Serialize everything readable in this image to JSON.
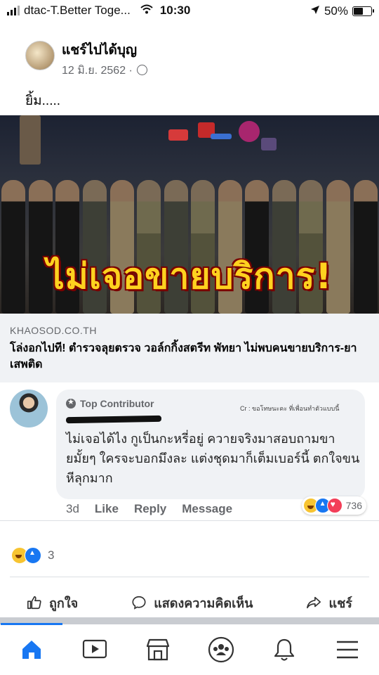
{
  "status_bar": {
    "carrier": "dtac-T.Better Toge...",
    "time": "10:30",
    "battery": "50%",
    "battery_level": 0.5
  },
  "post": {
    "page_name": "แชร์ไปได้บุญ",
    "date": "12 มิ.ย. 2562 ·",
    "text": "ยิ้ม.....",
    "image_headline": "ไม่เจอขายบริการ!",
    "link": {
      "domain": "KHAOSOD.CO.TH",
      "title": "โล่งอกไปที! ตำรวจลุยตรวจ วอล์กกิ้งสตรีท พัทยา ไม่พบคนขายบริการ-ยาเสพติด"
    },
    "reaction_count": "3",
    "actions": {
      "like": "ถูกใจ",
      "comment": "แสดงความคิดเห็น",
      "share": "แชร์"
    }
  },
  "comment": {
    "badge": "Top Contributor",
    "credit": "Cr : ขอโทษนะคะ ที่เพื่อนทำตัวแบบนี้",
    "text": "ไม่เจอได้ไง กูเป็นกะหรี่อยู่ ควายจริงมาสอบถามขายมั้ยๆ ใครจะบอกมึงละ แต่งชุดมาก็เต็มเบอร์นี้ ตกใจขนหีลุกมาก",
    "time": "3d",
    "like_label": "Like",
    "reply_label": "Reply",
    "message_label": "Message",
    "reaction_count": "736"
  },
  "icons": [
    "wifi-icon",
    "location-icon",
    "globe-icon",
    "home-icon",
    "watch-icon",
    "marketplace-icon",
    "groups-icon",
    "bell-icon",
    "menu-icon",
    "like-icon",
    "comment-icon",
    "share-icon"
  ],
  "colors": {
    "accent": "#1877f2",
    "text_secondary": "#65676b",
    "headline": "#ffd21f"
  }
}
